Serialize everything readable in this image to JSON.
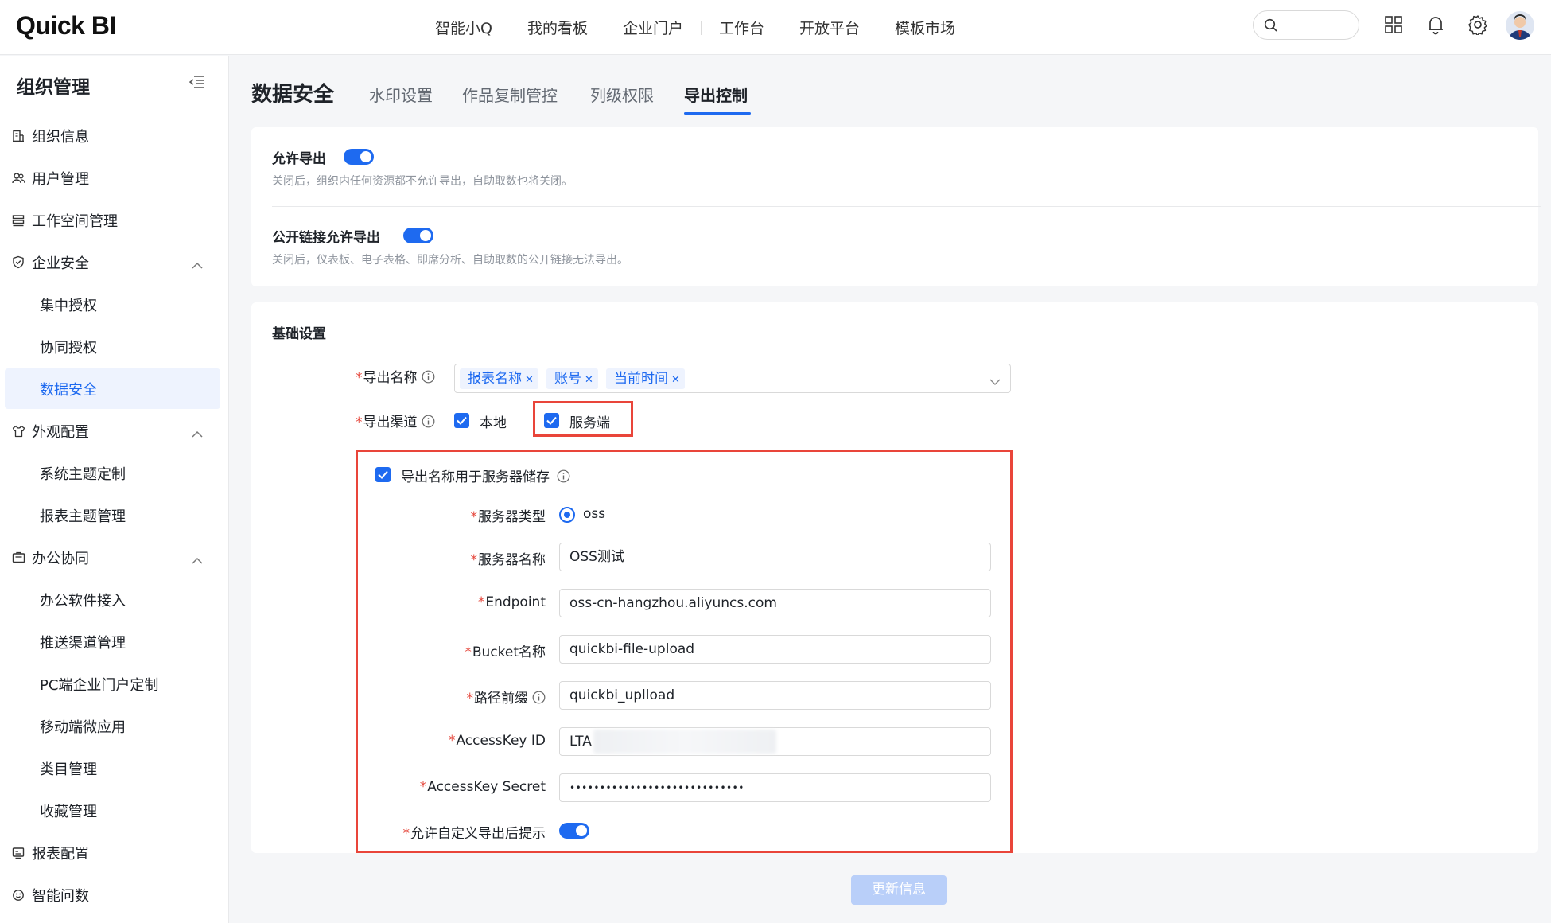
{
  "app": {
    "logo": "Quick BI"
  },
  "topnav": {
    "items": [
      "智能小Q",
      "我的看板",
      "企业门户",
      "工作台",
      "开放平台",
      "模板市场"
    ],
    "search_placeholder": ""
  },
  "sidebar": {
    "title": "组织管理",
    "items": [
      {
        "label": "组织信息",
        "icon": "building-icon"
      },
      {
        "label": "用户管理",
        "icon": "users-icon"
      },
      {
        "label": "工作空间管理",
        "icon": "stack-icon"
      },
      {
        "label": "企业安全",
        "icon": "shield-icon",
        "expanded": true
      },
      {
        "label": "集中授权",
        "child": true
      },
      {
        "label": "协同授权",
        "child": true
      },
      {
        "label": "数据安全",
        "child": true,
        "active": true
      },
      {
        "label": "外观配置",
        "icon": "shirt-icon",
        "expanded": true
      },
      {
        "label": "系统主题定制",
        "child": true
      },
      {
        "label": "报表主题管理",
        "child": true
      },
      {
        "label": "办公协同",
        "icon": "briefcase-icon",
        "expanded": true
      },
      {
        "label": "办公软件接入",
        "child": true
      },
      {
        "label": "推送渠道管理",
        "child": true
      },
      {
        "label": "PC端企业门户定制",
        "child": true
      },
      {
        "label": "移动端微应用",
        "child": true
      },
      {
        "label": "类目管理",
        "child": true
      },
      {
        "label": "收藏管理",
        "child": true
      },
      {
        "label": "报表配置",
        "icon": "report-icon"
      },
      {
        "label": "智能问数",
        "icon": "chat-icon"
      }
    ]
  },
  "main": {
    "title": "数据安全",
    "tabs": [
      "水印设置",
      "作品复制管控",
      "列级权限",
      "导出控制"
    ],
    "active_tab": "导出控制",
    "export_switches": [
      {
        "label": "允许导出",
        "desc": "关闭后，组织内任何资源都不允许导出，自助取数也将关闭。",
        "on": true
      },
      {
        "label": "公开链接允许导出",
        "desc": "关闭后，仪表板、电子表格、即席分析、自助取数的公开链接无法导出。",
        "on": true
      }
    ],
    "basic": {
      "title": "基础设置",
      "export_name_label": "导出名称",
      "export_name_tags": [
        "报表名称",
        "账号",
        "当前时间"
      ],
      "channel_label": "导出渠道",
      "channel_local": "本地",
      "channel_server": "服务端",
      "server_storage_label": "导出名称用于服务器储存",
      "server_type_label": "服务器类型",
      "server_type_value": "oss",
      "server_name_label": "服务器名称",
      "server_name_value": "OSS测试",
      "endpoint_label": "Endpoint",
      "endpoint_value": "oss-cn-hangzhou.aliyuncs.com",
      "bucket_label": "Bucket名称",
      "bucket_value": "quickbi-file-upload",
      "path_prefix_label": "路径前缀",
      "path_prefix_value": "quickbi_uplload",
      "access_key_id_label": "AccessKey ID",
      "access_key_id_value": "LTA",
      "access_key_secret_label": "AccessKey Secret",
      "access_key_secret_value": "•••••••••••••••••••••••••••••",
      "custom_tip_label": "允许自定义导出后提示",
      "custom_tip_on": true
    },
    "submit_label": "更新信息"
  },
  "colors": {
    "accent": "#1e6af0",
    "highlight": "#e9453a",
    "required": "#e5483d"
  }
}
